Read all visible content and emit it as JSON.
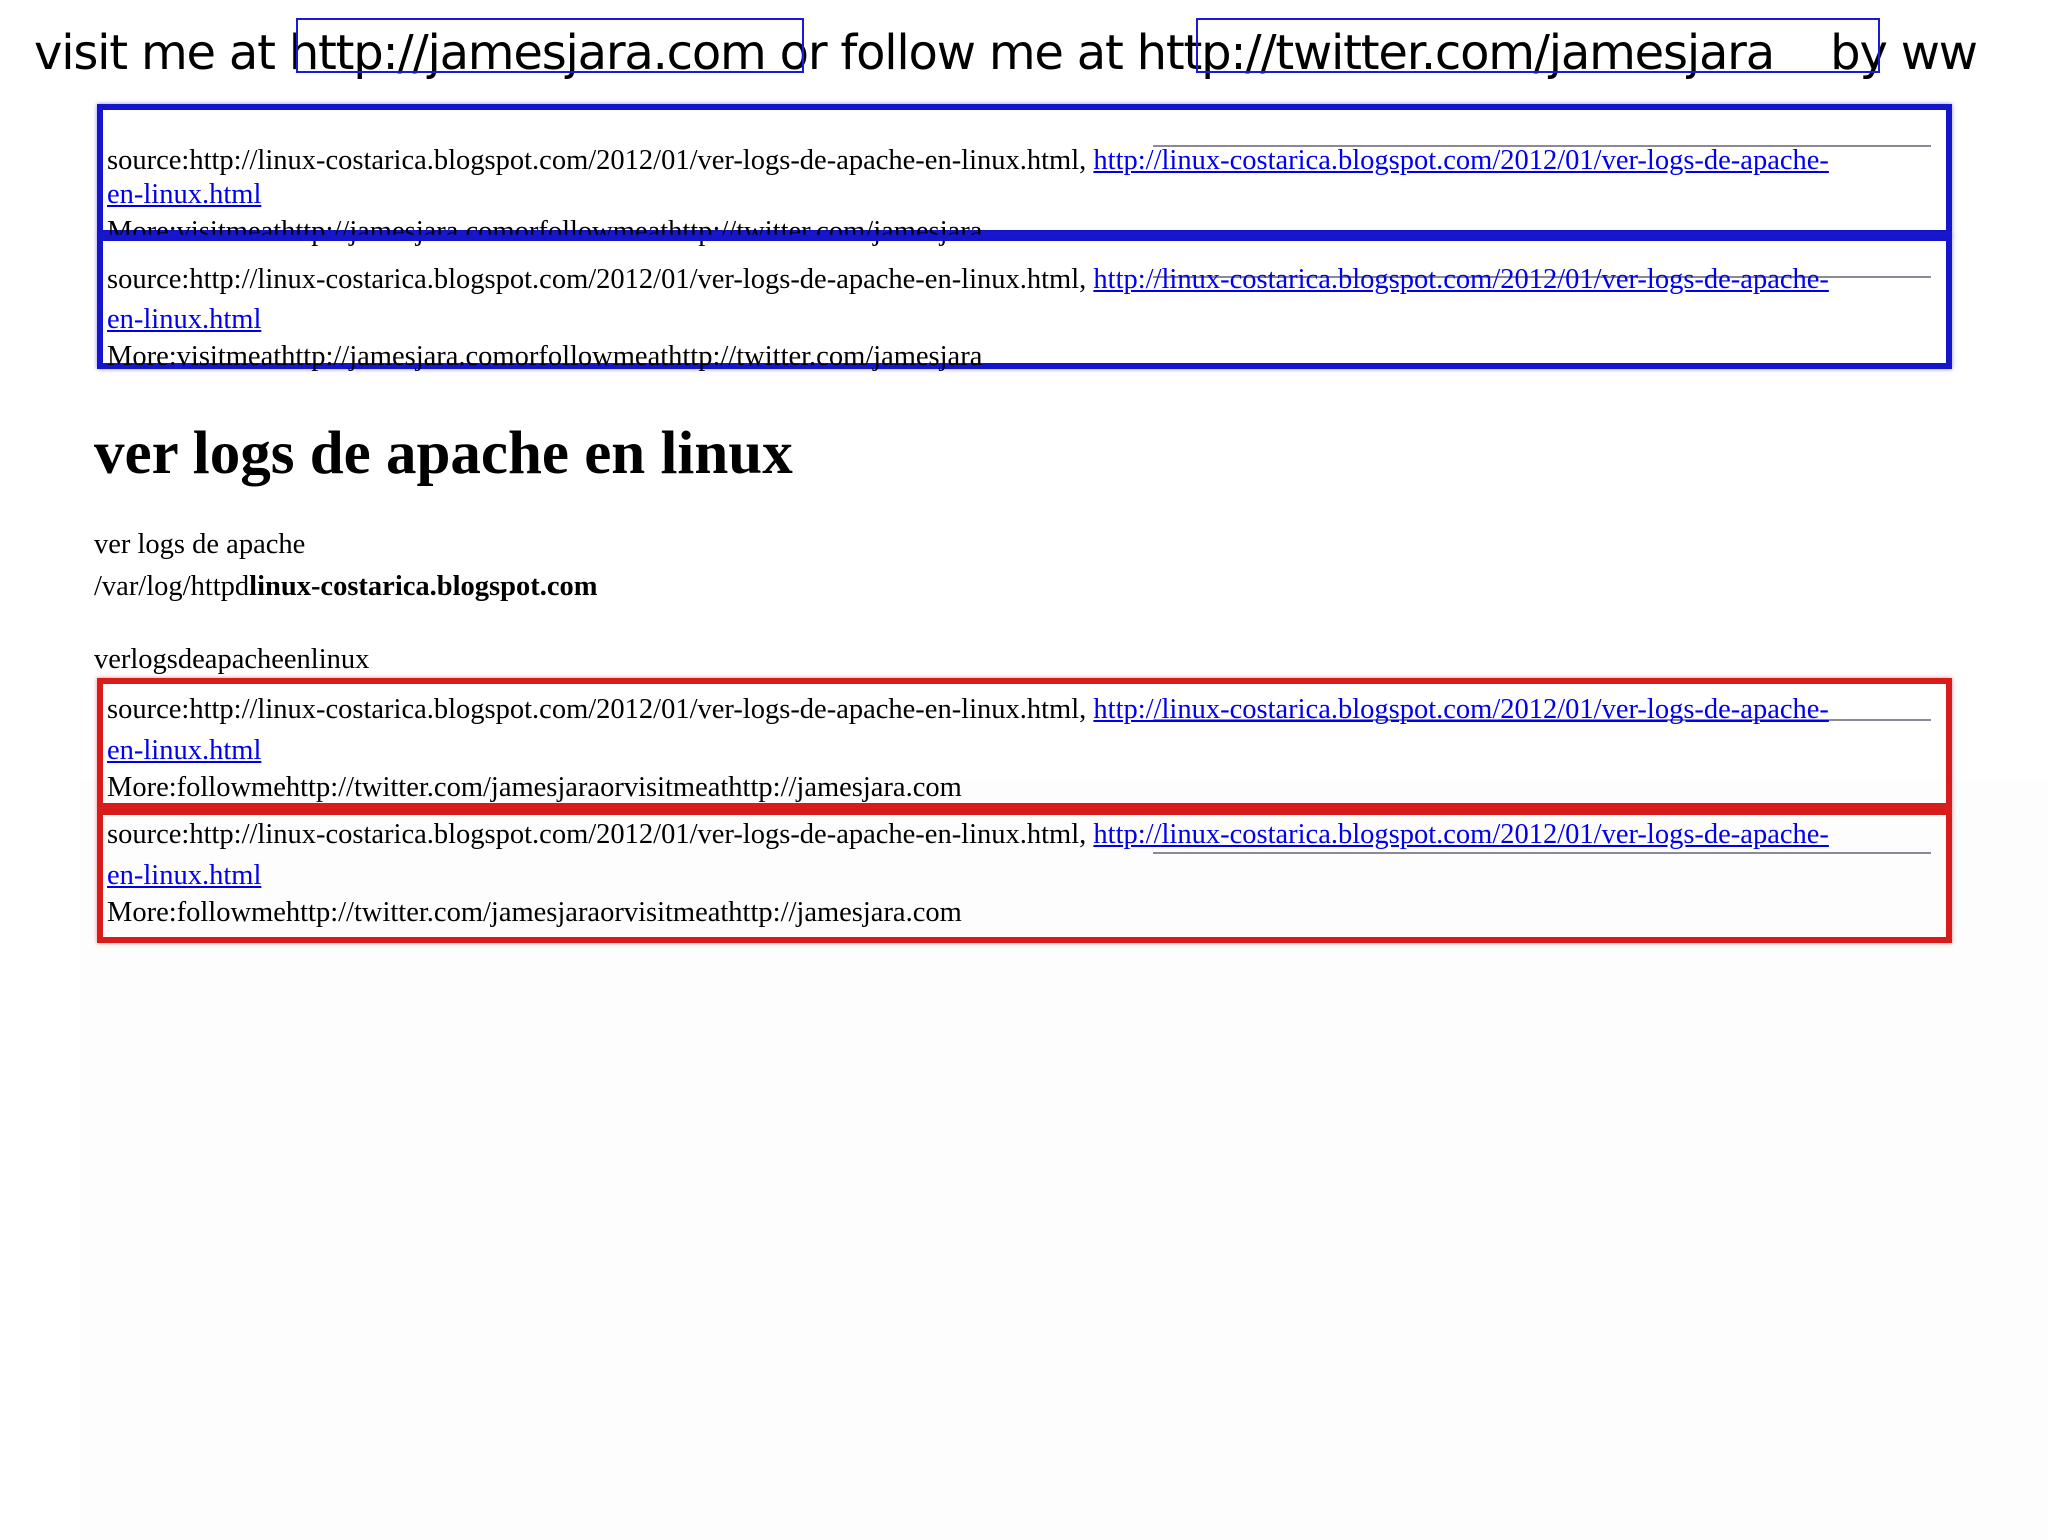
{
  "banner": {
    "prefix": "visit me at ",
    "site_url": "http://jamesjara.com",
    "middle": " or follow me at ",
    "twitter_url": "http://twitter.com/jamesjara",
    "suffix": "    by ww"
  },
  "source_blocks": [
    {
      "source_label": "source:",
      "source_url": "http://linux-costarica.blogspot.com/2012/01/ver-logs-de-apache-en-linux.html",
      "separator": ", ",
      "link_part1": "http://linux-costarica.blogspot.com/2012/01/ver-logs-de-apache-",
      "link_part2": "en-linux.html",
      "more": "More:visitmeathttp://jamesjara.comorfollowmeathttp://twitter.com/jamesjara",
      "border_color": "#1515cc"
    },
    {
      "source_label": "source:",
      "source_url": "http://linux-costarica.blogspot.com/2012/01/ver-logs-de-apache-en-linux.html",
      "separator": ", ",
      "link_part1": "http://linux-costarica.blogspot.com/2012/01/ver-logs-de-apache-",
      "link_part2": "en-linux.html",
      "more": "More:visitmeathttp://jamesjara.comorfollowmeathttp://twitter.com/jamesjara",
      "border_color": "#1515cc"
    },
    {
      "source_label": "source:",
      "source_url": "http://linux-costarica.blogspot.com/2012/01/ver-logs-de-apache-en-linux.html",
      "separator": ", ",
      "link_part1": "http://linux-costarica.blogspot.com/2012/01/ver-logs-de-apache-",
      "link_part2": "en-linux.html",
      "more": "More:followmehttp://twitter.com/jamesjaraorvisitmeathttp://jamesjara.com",
      "border_color": "#d81c1c"
    },
    {
      "source_label": "source:",
      "source_url": "http://linux-costarica.blogspot.com/2012/01/ver-logs-de-apache-en-linux.html",
      "separator": ", ",
      "link_part1": "http://linux-costarica.blogspot.com/2012/01/ver-logs-de-apache-",
      "link_part2": "en-linux.html",
      "more": "More:followmehttp://twitter.com/jamesjaraorvisitmeathttp://jamesjara.com",
      "border_color": "#d81c1c"
    }
  ],
  "article": {
    "title": "ver logs de apache en linux",
    "line1": "ver logs de apache",
    "line2_path": "/var/log/httpd",
    "line2_site": "linux-costarica.blogspot.com",
    "tags": "verlogsdeapacheenlinux"
  },
  "colors": {
    "link": "#0000ee",
    "blue_frame": "#1515cc",
    "red_frame": "#d81c1c"
  }
}
